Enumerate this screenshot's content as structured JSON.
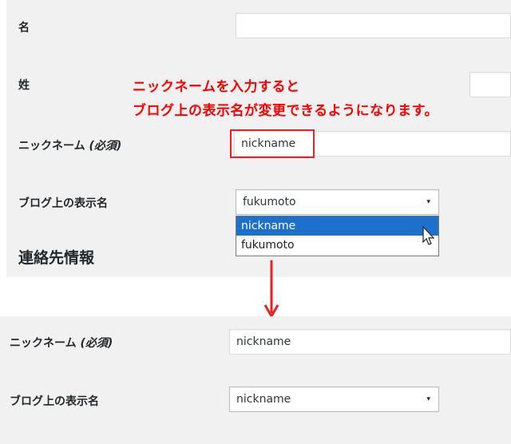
{
  "top": {
    "first_name_label": "名",
    "last_name_label": "姓",
    "nickname_label": "ニックネーム",
    "required_note": "(必須)",
    "nickname_value": "nickname",
    "display_name_label": "ブログ上の表示名",
    "display_name_selected": "fukumoto",
    "dropdown_options": [
      "nickname",
      "fukumoto"
    ],
    "contact_heading": "連絡先情報"
  },
  "annotation": {
    "line1": "ニックネームを入力すると",
    "line2": "ブログ上の表示名が変更できるようになります。",
    "color": "#ff0000"
  },
  "bottom": {
    "nickname_label": "ニックネーム",
    "required_note": "(必須)",
    "nickname_value": "nickname",
    "display_name_label": "ブログ上の表示名",
    "display_name_selected": "nickname"
  },
  "icons": {
    "select_arrow": "▾",
    "cursor": "mouse-pointer-icon",
    "transition_arrow": "arrow-down-icon"
  },
  "colors": {
    "highlight": "#1e70cd",
    "panel_bg": "#f1f1f1"
  }
}
